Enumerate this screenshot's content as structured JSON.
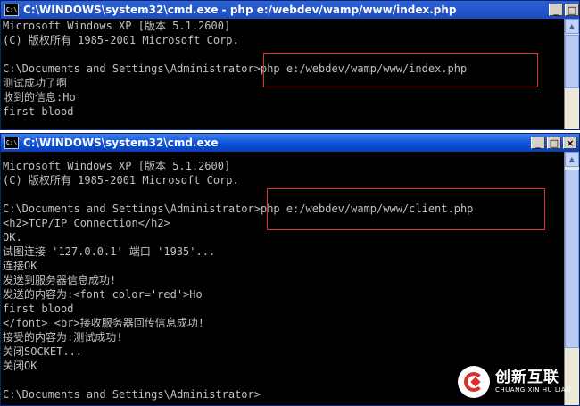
{
  "window1": {
    "title": "C:\\WINDOWS\\system32\\cmd.exe - php e:/webdev/wamp/www/index.php",
    "lines": [
      "Microsoft Windows XP [版本 5.1.2600]",
      "(C) 版权所有 1985-2001 Microsoft Corp.",
      "",
      "C:\\Documents and Settings\\Administrator>php e:/webdev/wamp/www/index.php",
      "测试成功了啊",
      "收到的信息:Ho",
      "first blood"
    ]
  },
  "window2": {
    "title": "C:\\WINDOWS\\system32\\cmd.exe",
    "lines": [
      "Microsoft Windows XP [版本 5.1.2600]",
      "(C) 版权所有 1985-2001 Microsoft Corp.",
      "",
      "C:\\Documents and Settings\\Administrator>php e:/webdev/wamp/www/client.php",
      "<h2>TCP/IP Connection</h2>",
      "OK.",
      "试图连接 '127.0.0.1' 端口 '1935'...",
      "连接OK",
      "发送到服务器信息成功!",
      "发送的内容为:<font color='red'>Ho",
      "first blood",
      "</font> <br>接收服务器回传信息成功!",
      "接受的内容为:测试成功!",
      "关闭SOCKET...",
      "关闭OK",
      "",
      "C:\\Documents and Settings\\Administrator>"
    ]
  },
  "controls": {
    "minimize": "_",
    "maximize": "□",
    "close": "×"
  },
  "brand": {
    "name": "创新互联",
    "sub": "CHUANG XIN HU LIAN"
  },
  "colors": {
    "console_bg": "#000000",
    "console_text": "#c0c0c0",
    "title_bar": "#0b4fd7",
    "highlight": "#e03030"
  }
}
